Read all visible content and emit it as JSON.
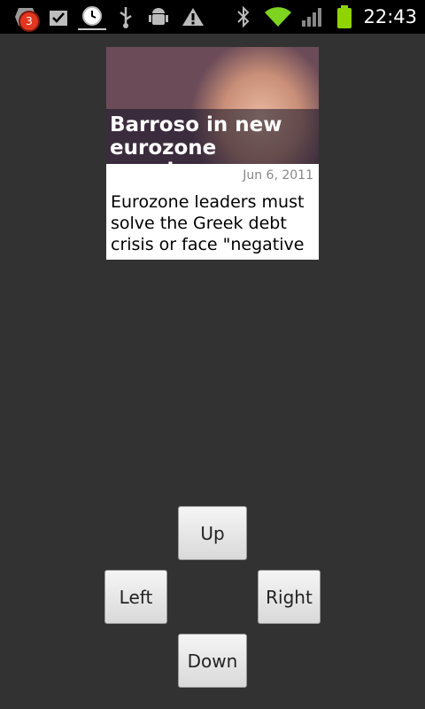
{
  "status_bar": {
    "notification_count": "3",
    "time": "22:43",
    "icons": [
      "notification-app-icon",
      "task-check-icon",
      "clock-icon",
      "usb-icon",
      "android-debug-icon",
      "warning-icon",
      "bluetooth-icon",
      "wifi-icon",
      "signal-icon",
      "battery-icon"
    ],
    "battery_color": "#8fd400",
    "wifi_color": "#7ed321"
  },
  "news_widget": {
    "headline": "Barroso in new eurozone warning",
    "date": "Jun 6, 2011",
    "summary": "Eurozone leaders must solve the Greek debt crisis or face \"negative"
  },
  "controls": {
    "up_label": "Up",
    "left_label": "Left",
    "right_label": "Right",
    "down_label": "Down"
  }
}
